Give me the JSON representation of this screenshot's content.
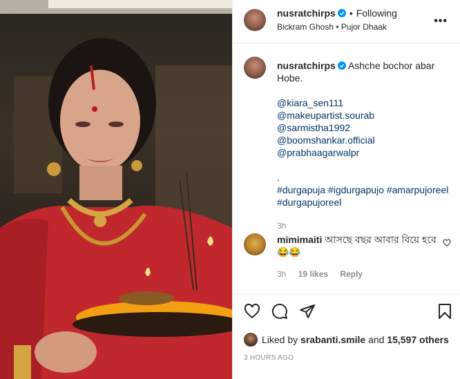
{
  "post": {
    "username": "nusratchirps",
    "follow_separator": "•",
    "follow_status": "Following",
    "audio": "Bickram Ghosh • Pujor Dhaak",
    "more_icon": "more-options-icon"
  },
  "caption": {
    "username": "nusratchirps",
    "text": "Ashche bochor abar Hobe.",
    "mentions": [
      "@kiara_sen111",
      "@makeupartist.sourab",
      "@sarmistha1992",
      "@boomshankar.official",
      "@prabhaagarwalpr"
    ],
    "separator": ".",
    "hashtags": [
      "#durgapuja",
      "#igdurgapujo",
      "#amarpujoreel",
      "#durgapujoreel"
    ],
    "time": "3h"
  },
  "comment": {
    "username": "mimimaiti",
    "text": "আসছে বছর আবার বিয়ে হবে 😂😂",
    "time": "3h",
    "likes": "19 likes",
    "reply": "Reply"
  },
  "likes_line": {
    "prefix": "Liked by",
    "user": "srabanti.smile",
    "and": "and",
    "count": "15,597 others"
  },
  "posted_time": "3 HOURS AGO",
  "colors": {
    "link": "#00376b",
    "verified": "#0095f6",
    "muted": "#8e8e8e",
    "saree": "#c0282d"
  }
}
